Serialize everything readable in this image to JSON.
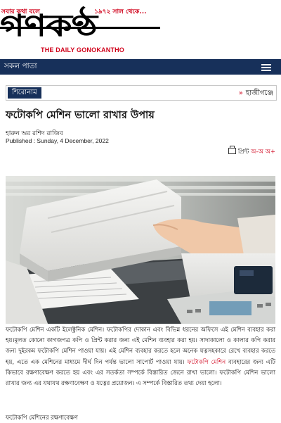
{
  "masthead": {
    "tagline": "সবার কথা বলে",
    "since": "১৯৭২ সাল থেকে...",
    "logo_text": "গণকণ্ঠ",
    "english_name": "THE DAILY GONOKANTHO"
  },
  "nav": {
    "all_pages": "সকল পাতা",
    "menu_icon": "hamburger-icon"
  },
  "ticker": {
    "label": "শিরোনাম",
    "arrow": "»",
    "headline": "হাজীগঞ্জে"
  },
  "article": {
    "title": "ফটোকপি মেশিন ভালো রাখার উপায়",
    "author": "হারুন অর রশিদ রাজিব",
    "published": "Published : Sunday, 4 December, 2022",
    "print_label": "প্রিন্ট",
    "font_controls": "অ-অ অ+",
    "body_1": "ফটোকপি মেশিন একটি ইলেক্ট্রনিক মেশিন। ফটোকপির দোকান এবং বিভিন্ন ধরনের অফিসে এই মেশিন ব্যবহার করা হয়।মূলত কোনো কাগজপত্র কপি ও প্রিন্ট করার জন্য এই মেশিন ব্যবহার করা হয়। সাদাকালো ও কালার কপি করার জন্য দুইরকম ফটোকপি মেশিন পাওয়া যায়। এই মেশিন ব্যবহার করতে হলে অনেক যত্নসহকারে রেখে ব্যবহার করতে হয়, এতে এক মেশিনের মাধ্যমে দীর্ঘ দিন পর্যন্ত ভালো সাপোর্ট পাওয়া যায়।",
    "link_text": "ফটোকপি মেশিন",
    "body_2": "ব্যবহারের জন্য এটি কিভাবে রক্ষণাবেক্ষণ করতে হয় এবং এর সতর্কতা সম্পর্কে বিস্তারিত জেনে রাখা ভালো। ফটোকপি মেশিন ভালো রাখার জন্য এর যথাযথ রক্ষণাবেক্ষণ ও যত্নের প্রয়োজন। এ সম্পর্কে বিস্তারিত তথ্য দেয়া হলো।",
    "subhead": "ফটোকপি মেশিনের রক্ষণাবেক্ষণ"
  },
  "colors": {
    "brand_red": "#d0021b",
    "nav_blue": "#17305a"
  }
}
